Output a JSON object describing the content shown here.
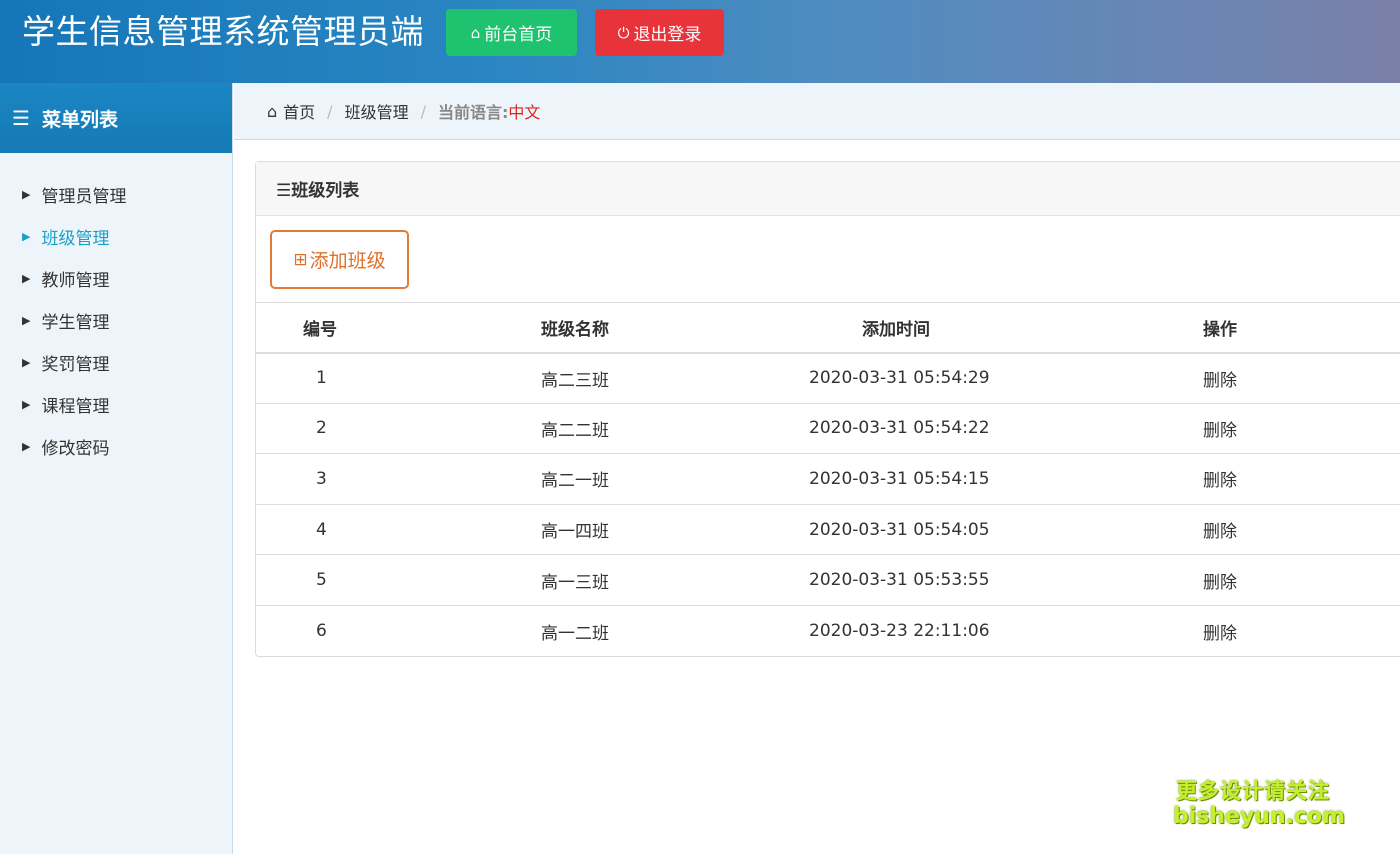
{
  "header": {
    "title": "学生信息管理系统管理员端",
    "home_button": "前台首页",
    "logout_button": "退出登录"
  },
  "sidebar": {
    "title": "菜单列表",
    "items": [
      {
        "label": "管理员管理",
        "active": false
      },
      {
        "label": "班级管理",
        "active": true
      },
      {
        "label": "教师管理",
        "active": false
      },
      {
        "label": "学生管理",
        "active": false
      },
      {
        "label": "奖罚管理",
        "active": false
      },
      {
        "label": "课程管理",
        "active": false
      },
      {
        "label": "修改密码",
        "active": false
      }
    ]
  },
  "breadcrumb": {
    "home": "首页",
    "current": "班级管理",
    "language_label": "当前语言:",
    "language_value": "中文"
  },
  "panel": {
    "title": "☰班级列表",
    "add_button": "添加班级"
  },
  "table": {
    "headers": [
      "编号",
      "班级名称",
      "添加时间",
      "操作"
    ],
    "rows": [
      {
        "id": "1",
        "name": "高二三班",
        "time": "2020-03-31 05:54:29",
        "action": "删除"
      },
      {
        "id": "2",
        "name": "高二二班",
        "time": "2020-03-31 05:54:22",
        "action": "删除"
      },
      {
        "id": "3",
        "name": "高二一班",
        "time": "2020-03-31 05:54:15",
        "action": "删除"
      },
      {
        "id": "4",
        "name": "高一四班",
        "time": "2020-03-31 05:54:05",
        "action": "删除"
      },
      {
        "id": "5",
        "name": "高一三班",
        "time": "2020-03-31 05:53:55",
        "action": "删除"
      },
      {
        "id": "6",
        "name": "高一二班",
        "time": "2020-03-23 22:11:06",
        "action": "删除"
      }
    ]
  },
  "watermark": {
    "line1": "更多设计请关注",
    "line2": "bisheyun.com"
  },
  "colors": {
    "header_start": "#1576b8",
    "home_button": "#1fc36f",
    "logout_button": "#e8333a",
    "active_menu": "#1ba0c8",
    "add_button": "#e07028",
    "language_value": "#d9261c"
  },
  "icons": {
    "home": "home-icon",
    "power": "power-icon",
    "list": "list-icon",
    "menu_arrow": "caret-right-icon",
    "add": "plus-square-icon"
  }
}
